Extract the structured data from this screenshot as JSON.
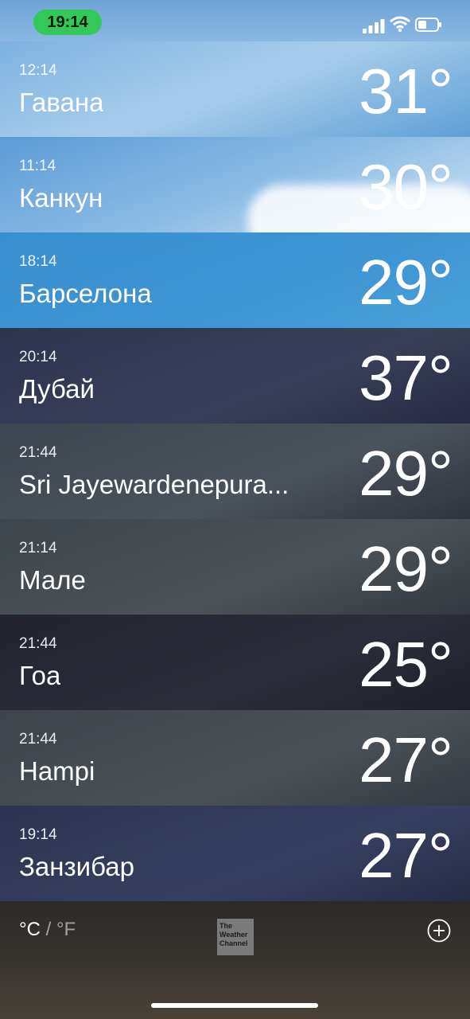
{
  "status_bar": {
    "time": "19:14",
    "icons": [
      "signal-icon",
      "wifi-icon",
      "battery-icon"
    ]
  },
  "cities": [
    {
      "time": "12:14",
      "name": "Гавана",
      "temp": "31°"
    },
    {
      "time": "11:14",
      "name": "Канкун",
      "temp": "30°"
    },
    {
      "time": "18:14",
      "name": "Барселона",
      "temp": "29°"
    },
    {
      "time": "20:14",
      "name": "Дубай",
      "temp": "37°"
    },
    {
      "time": "21:44",
      "name": "Sri Jayewardenepura...",
      "temp": "29°"
    },
    {
      "time": "21:14",
      "name": "Мале",
      "temp": "29°"
    },
    {
      "time": "21:44",
      "name": "Гоа",
      "temp": "25°"
    },
    {
      "time": "21:44",
      "name": "Hampi",
      "temp": "27°"
    },
    {
      "time": "19:14",
      "name": "Занзибар",
      "temp": "27°"
    }
  ],
  "footer": {
    "celsius": "°C",
    "separator": "/",
    "fahrenheit": "°F",
    "logo_text": "The Weather Channel",
    "add_icon": "plus-circle-icon"
  }
}
